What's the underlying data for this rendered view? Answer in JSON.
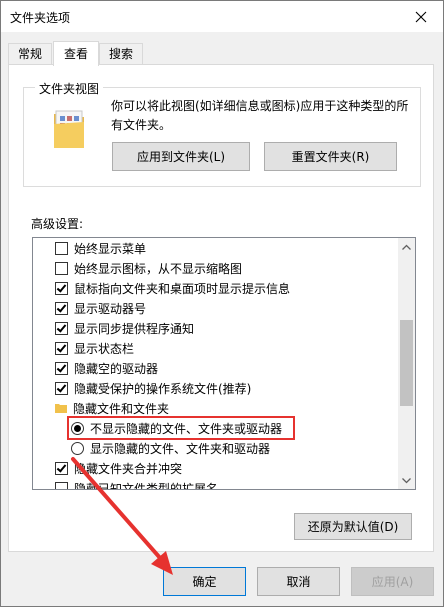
{
  "window": {
    "title": "文件夹选项"
  },
  "tabs": [
    {
      "label": "常规",
      "active": false
    },
    {
      "label": "查看",
      "active": true
    },
    {
      "label": "搜索",
      "active": false
    }
  ],
  "folder_views": {
    "title": "文件夹视图",
    "description_line1": "你可以将此视图(如详细信息或图标)应用于这种类型的所",
    "description_line2": "有文件夹。",
    "apply_button": "应用到文件夹(L)",
    "reset_button": "重置文件夹(R)"
  },
  "advanced": {
    "label": "高级设置:",
    "items": [
      {
        "type": "checkbox",
        "checked": false,
        "label": "始终显示菜单"
      },
      {
        "type": "checkbox",
        "checked": false,
        "label": "始终显示图标，从不显示缩略图"
      },
      {
        "type": "checkbox",
        "checked": true,
        "label": "鼠标指向文件夹和桌面项时显示提示信息"
      },
      {
        "type": "checkbox",
        "checked": true,
        "label": "显示驱动器号"
      },
      {
        "type": "checkbox",
        "checked": true,
        "label": "显示同步提供程序通知"
      },
      {
        "type": "checkbox",
        "checked": true,
        "label": "显示状态栏"
      },
      {
        "type": "checkbox",
        "checked": true,
        "label": "隐藏空的驱动器"
      },
      {
        "type": "checkbox",
        "checked": true,
        "label": "隐藏受保护的操作系统文件(推荐)"
      },
      {
        "type": "folder",
        "label": "隐藏文件和文件夹"
      },
      {
        "type": "radio",
        "checked": true,
        "label": "不显示隐藏的文件、文件夹或驱动器"
      },
      {
        "type": "radio",
        "checked": false,
        "label": "显示隐藏的文件、文件夹和驱动器"
      },
      {
        "type": "checkbox",
        "checked": true,
        "label": "隐藏文件夹合并冲突"
      },
      {
        "type": "checkbox",
        "checked": false,
        "label": "隐藏已知文件类型的扩展名"
      }
    ],
    "restore_button": "还原为默认值(D)"
  },
  "footer": {
    "ok": "确定",
    "cancel": "取消",
    "apply": "应用(A)"
  },
  "colors": {
    "highlight": "#e6322f",
    "focus": "#0078d7"
  }
}
